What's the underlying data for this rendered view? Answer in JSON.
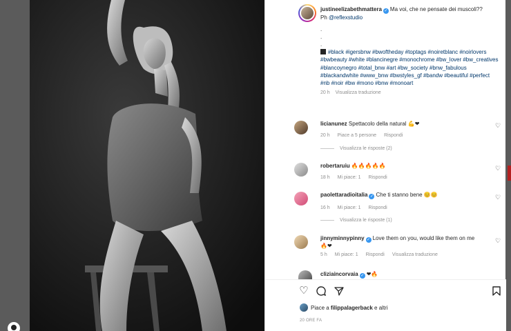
{
  "post": {
    "author": "justineelizabethmattera",
    "caption_line1": "Ma voi, che ne pensate dei muscoli??",
    "caption_line2_prefix": "Ph ",
    "caption_line2_link": "@reflexstudio",
    "dots": [
      ".",
      ".",
      "."
    ],
    "hashtags": "#black #igersbnw #bwoftheday #toptags #noiretblanc #noirlovers #bwbeauty #white #blancinegre #monochrome #bw_lover #bw_creatives #blancoynegro #total_bnw #art #bw_society #bnw_fabulous #blackandwhite #www_bnw #bwstyles_gf #bandw #beautiful #perfect #nb #noir #bw #mono #bnw #monoart",
    "time": "20 h",
    "see_translation": "Visualizza traduzione"
  },
  "comments": [
    {
      "user": "licianunez",
      "text": "Spettacolo della natural",
      "emoji": "💪❤",
      "time": "20 h",
      "likes": "Piace a 5 persone",
      "reply": "Rispondi",
      "verified": false
    },
    {
      "user": "robertaruiu",
      "text": "",
      "emoji": "🔥🔥🔥🔥🔥",
      "time": "18 h",
      "likes": "Mi piace: 1",
      "reply": "Rispondi",
      "verified": false
    },
    {
      "user": "paolettaradioitalia",
      "text": "Che ti stanno bene",
      "emoji": "😊😊",
      "time": "16 h",
      "likes": "Mi piace: 1",
      "reply": "Rispondi",
      "verified": true
    },
    {
      "user": "jinnyminnypinny",
      "text": "Love them on you, would like them on me",
      "emoji": "🔥❤",
      "time": "5 h",
      "likes": "Mi piace: 1",
      "reply": "Rispondi",
      "translate": "Visualizza traduzione",
      "verified": true
    },
    {
      "user": "cliziaincorvaia",
      "text": "",
      "emoji": "❤🔥",
      "verified": true
    }
  ],
  "view_replies": [
    "Visualizza le risposte (2)",
    "Visualizza le risposte (1)"
  ],
  "footer": {
    "liked_by_prefix": "Piace a ",
    "liked_by_user": "filippalagerback",
    "liked_by_suffix": " e altri",
    "posted_ago": "20 ORE FA"
  },
  "icons": [
    "heart-icon",
    "comment-icon",
    "share-icon",
    "bookmark-icon",
    "verified-badge-icon",
    "profile-icon"
  ],
  "colors": {
    "link": "#00376b",
    "verified": "#3897f0",
    "muted": "#8e8e8e"
  }
}
